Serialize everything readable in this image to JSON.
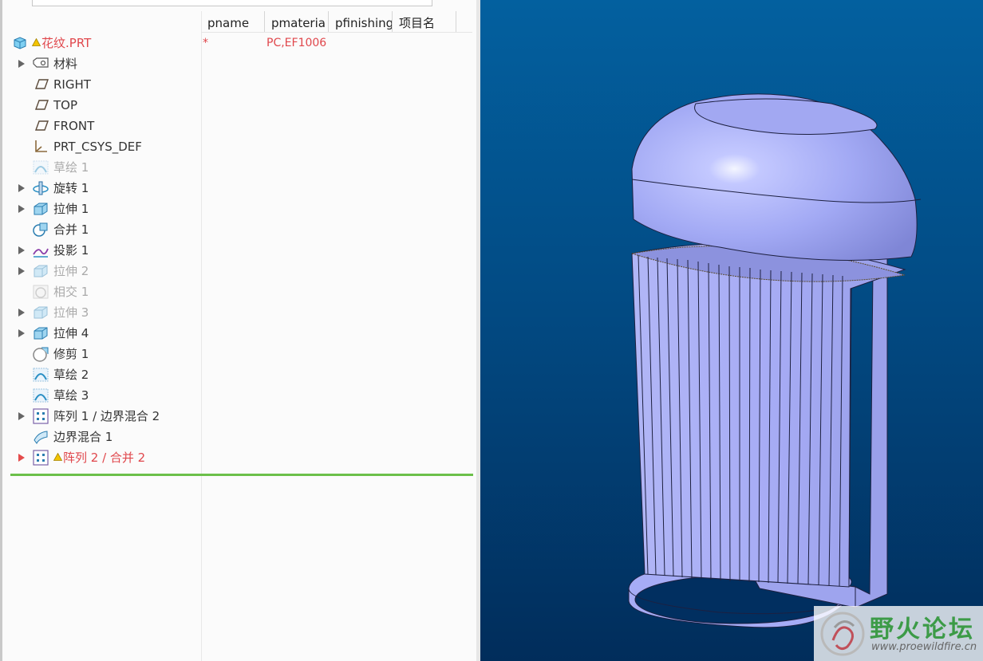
{
  "columns": [
    "pname",
    "pmateria",
    "pfinishing",
    "项目名"
  ],
  "tree": [
    {
      "label": "花纹.PRT",
      "icon": "part-icon",
      "expandable": false,
      "style": "red",
      "warn": true,
      "pname": "*",
      "pmaterial": "PC,EF1006"
    },
    {
      "label": "材料",
      "icon": "material-icon",
      "expandable": true,
      "style": "normal"
    },
    {
      "label": "RIGHT",
      "icon": "datum-plane-icon",
      "expandable": false,
      "style": "normal"
    },
    {
      "label": "TOP",
      "icon": "datum-plane-icon",
      "expandable": false,
      "style": "normal"
    },
    {
      "label": "FRONT",
      "icon": "datum-plane-icon",
      "expandable": false,
      "style": "normal"
    },
    {
      "label": "PRT_CSYS_DEF",
      "icon": "coordinate-system-icon",
      "expandable": false,
      "style": "normal"
    },
    {
      "label": "草绘 1",
      "icon": "sketch-icon",
      "expandable": false,
      "style": "dim"
    },
    {
      "label": "旋转 1",
      "icon": "revolve-icon",
      "expandable": true,
      "style": "normal"
    },
    {
      "label": "拉伸 1",
      "icon": "extrude-icon",
      "expandable": true,
      "style": "normal"
    },
    {
      "label": "合并 1",
      "icon": "merge-icon",
      "expandable": false,
      "style": "normal"
    },
    {
      "label": "投影 1",
      "icon": "projection-icon",
      "expandable": true,
      "style": "normal"
    },
    {
      "label": "拉伸 2",
      "icon": "extrude-icon",
      "expandable": true,
      "style": "dim"
    },
    {
      "label": "相交 1",
      "icon": "intersect-icon",
      "expandable": false,
      "style": "dim"
    },
    {
      "label": "拉伸 3",
      "icon": "extrude-icon",
      "expandable": true,
      "style": "dim"
    },
    {
      "label": "拉伸 4",
      "icon": "extrude-icon",
      "expandable": true,
      "style": "normal"
    },
    {
      "label": "修剪 1",
      "icon": "trim-icon",
      "expandable": false,
      "style": "normal"
    },
    {
      "label": "草绘 2",
      "icon": "sketch-icon",
      "expandable": false,
      "style": "normal"
    },
    {
      "label": "草绘 3",
      "icon": "sketch-icon",
      "expandable": false,
      "style": "normal"
    },
    {
      "label": "阵列 1 / 边界混合 2",
      "icon": "pattern-icon",
      "expandable": true,
      "style": "normal"
    },
    {
      "label": "边界混合 1",
      "icon": "boundary-blend-icon",
      "expandable": false,
      "style": "normal"
    },
    {
      "label": "阵列 2 / 合并 2",
      "icon": "pattern-icon",
      "expandable": true,
      "style": "red",
      "warn": true
    }
  ],
  "watermark": {
    "title": "野火论坛",
    "url": "www.proewildfire.cn"
  },
  "colors": {
    "viewport_top": "#03609f",
    "viewport_bottom": "#012d5b",
    "model_fill": "#a6acf6",
    "error_text": "#e0474c",
    "insert_line": "#6cc04a"
  }
}
